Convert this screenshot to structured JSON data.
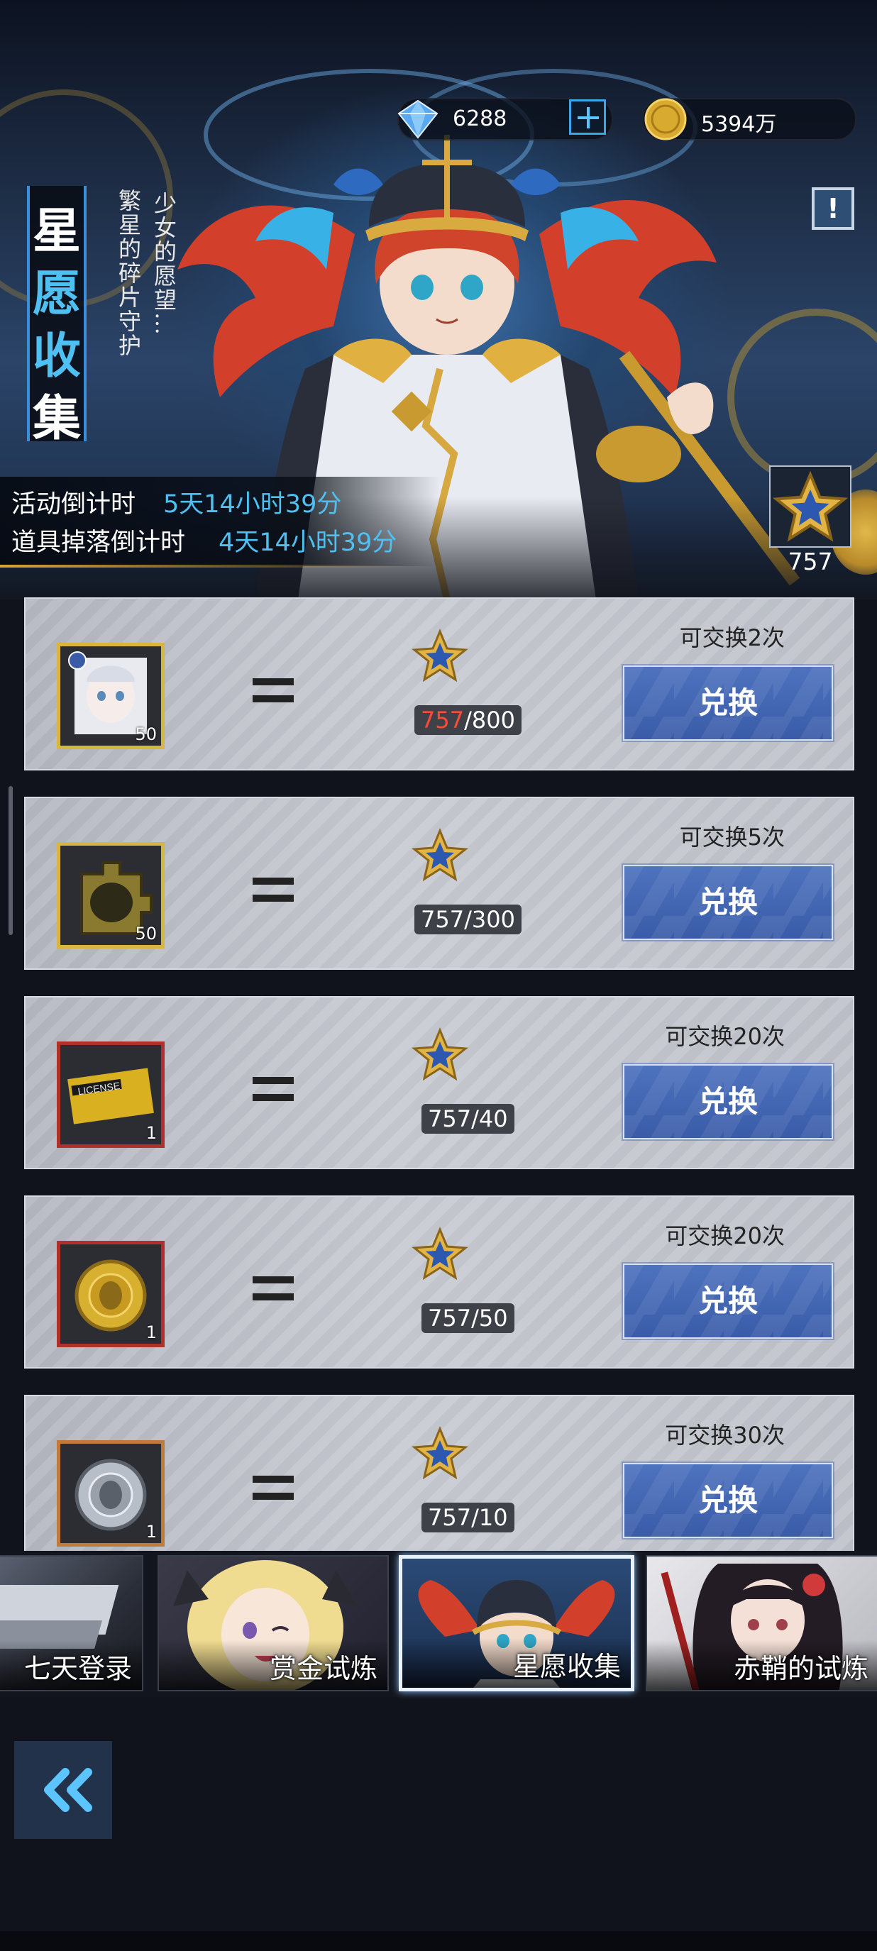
{
  "currency": {
    "gems": "6288",
    "coins": "5394万"
  },
  "banner": {
    "title_chars": [
      "星",
      "愿",
      "收",
      "集"
    ],
    "subtitle_line1": "少女的愿望…",
    "subtitle_line2": "繁星的碎片守护",
    "countdown": {
      "event_label": "活动倒计时",
      "event_value": "5天14小时39分",
      "drop_label": "道具掉落倒计时",
      "drop_value": "4天14小时39分"
    },
    "token_count": "757"
  },
  "rows": [
    {
      "item": "character-fragment",
      "border": "#d6b640",
      "qty": "50",
      "cost_current": "757",
      "cost_required": "/800",
      "insufficient": true,
      "limit": "可交换2次",
      "button": "兑换"
    },
    {
      "item": "gold-fragment",
      "border": "#d6b640",
      "qty": "50",
      "cost_current": "757",
      "cost_required": "/300",
      "insufficient": false,
      "limit": "可交换5次",
      "button": "兑换"
    },
    {
      "item": "license-card",
      "border": "#b0302c",
      "qty": "1",
      "cost_current": "757",
      "cost_required": "/40",
      "insufficient": false,
      "limit": "可交换20次",
      "button": "兑换"
    },
    {
      "item": "gold-medal",
      "border": "#b0302c",
      "qty": "1",
      "cost_current": "757",
      "cost_required": "/50",
      "insufficient": false,
      "limit": "可交换20次",
      "button": "兑换"
    },
    {
      "item": "silver-medal",
      "border": "#c07a3a",
      "qty": "1",
      "cost_current": "757",
      "cost_required": "/10",
      "insufficient": false,
      "limit": "可交换30次",
      "button": "兑换"
    }
  ],
  "tabs": [
    {
      "label": "七天登录",
      "active": false
    },
    {
      "label": "赏金试炼",
      "active": false
    },
    {
      "label": "星愿收集",
      "active": true
    },
    {
      "label": "赤鞘的试炼",
      "active": false
    }
  ],
  "colors": {
    "accent_blue": "#4fc0f2",
    "button_blue": "#3a5ca8",
    "insufficient_red": "#ff4a3a",
    "gold": "#d6b640"
  }
}
